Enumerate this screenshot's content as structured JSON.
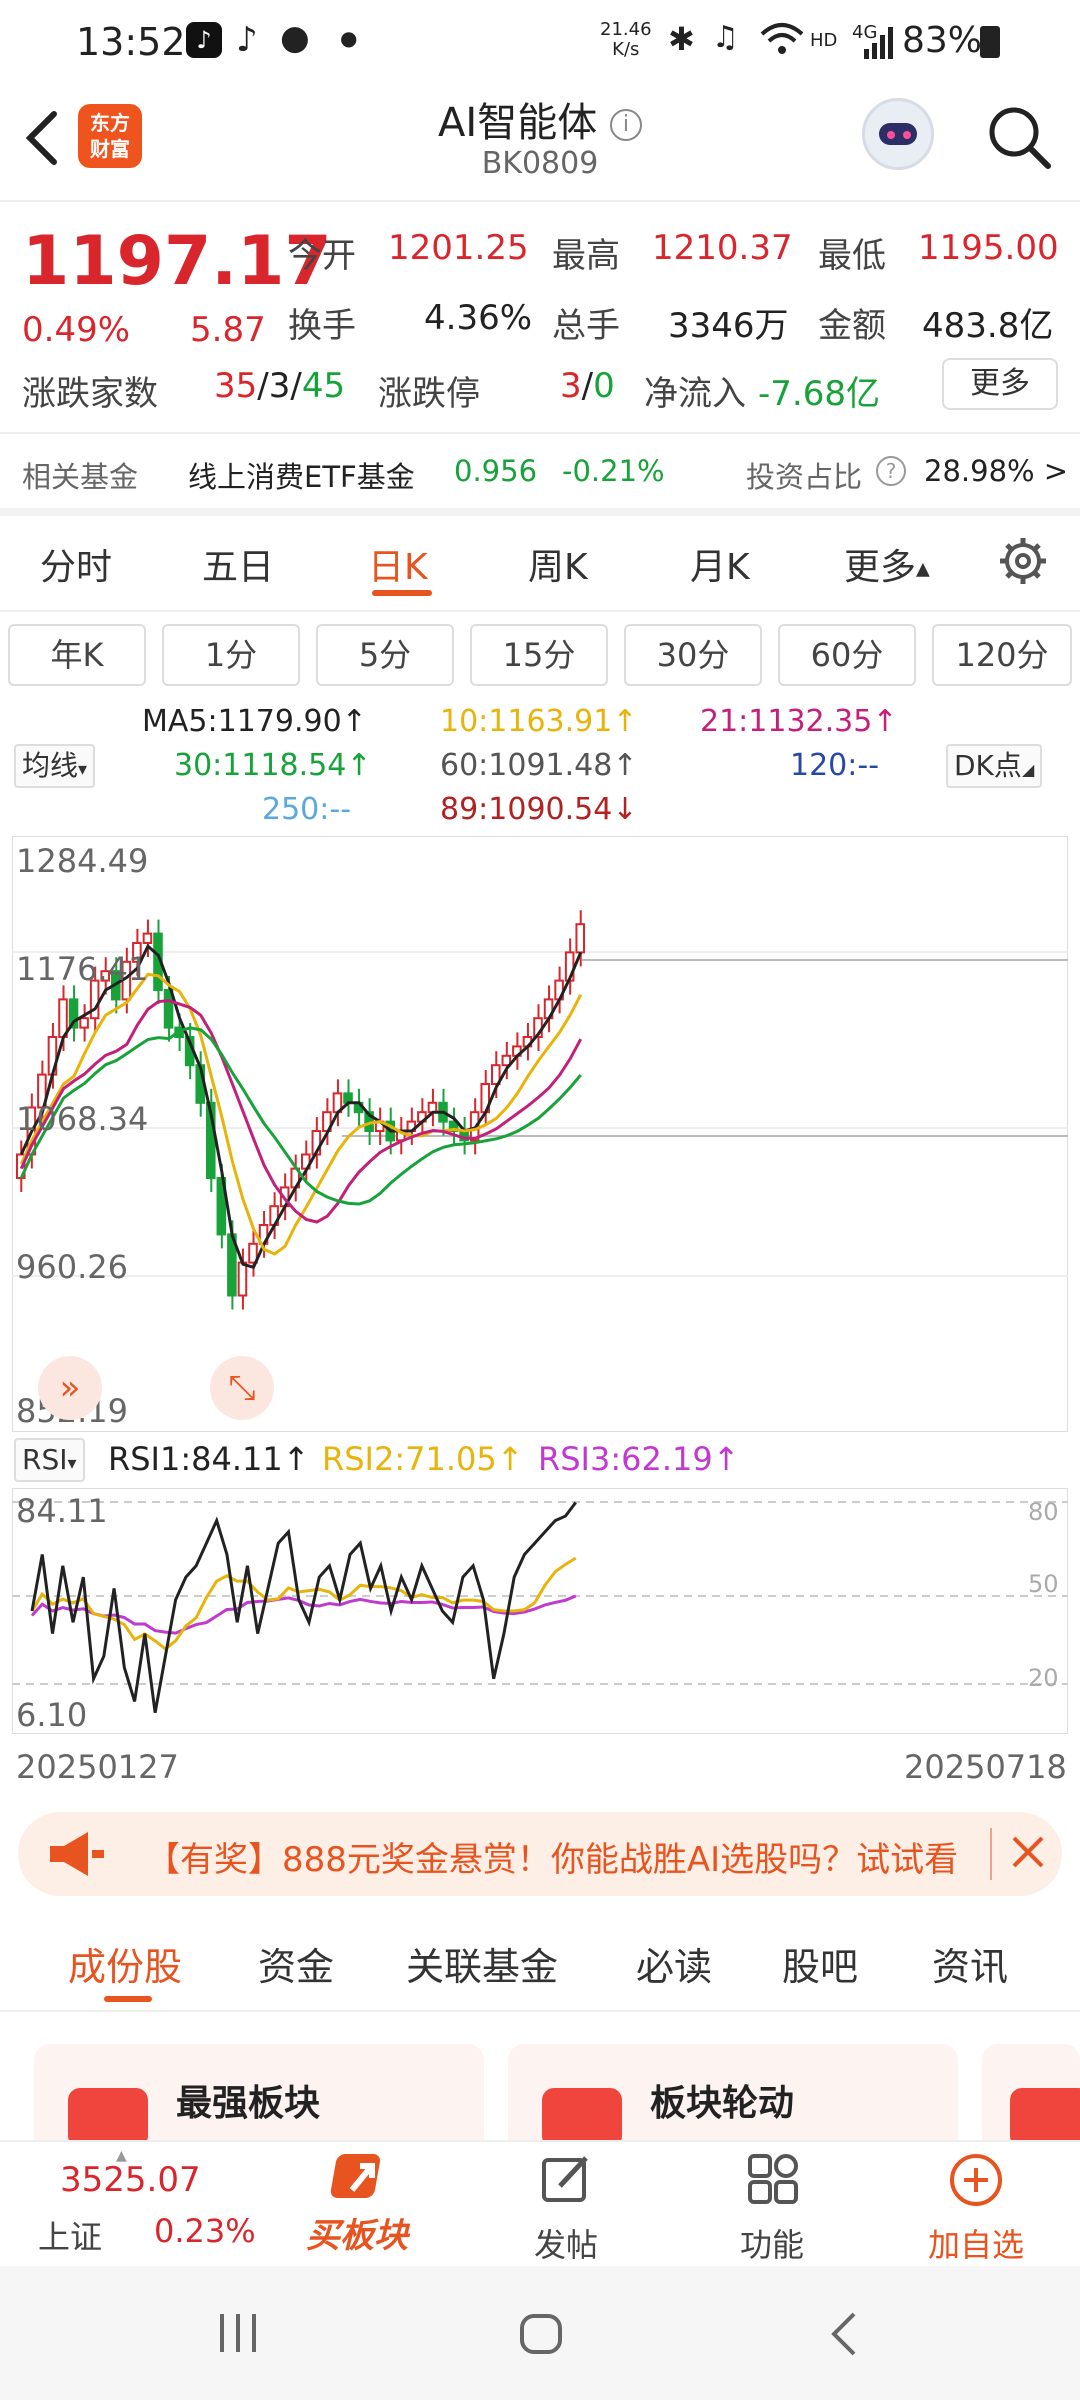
{
  "status_bar": {
    "time": "13:52",
    "net_speed_top": "21.46",
    "net_speed_unit": "K/s",
    "network": "HD",
    "signal": "4G",
    "battery": "83%"
  },
  "header": {
    "logo_text_1": "东方",
    "logo_text_2": "财富",
    "title": "AI智能体",
    "code": "BK0809"
  },
  "quote": {
    "price": "1197.17",
    "change_pct": "0.49%",
    "change": "5.87",
    "open_label": "今开",
    "open": "1201.25",
    "high_label": "最高",
    "high": "1210.37",
    "low_label": "最低",
    "low": "1195.00",
    "turnover_label": "换手",
    "turnover": "4.36%",
    "volume_label": "总手",
    "volume": "3346万",
    "amount_label": "金额",
    "amount": "483.8亿",
    "updown_label": "涨跌家数",
    "up_count": "35",
    "flat_count": "3",
    "down_count": "45",
    "limit_label": "涨跌停",
    "limit_up": "3",
    "limit_down": "0",
    "netflow_label": "净流入",
    "netflow": "-7.68亿",
    "more_label": "更多"
  },
  "fund": {
    "label": "相关基金",
    "name": "线上消费ETF基金",
    "price": "0.956",
    "change": "-0.21%",
    "ratio_label": "投资占比",
    "ratio": "28.98% >"
  },
  "period_tabs": [
    "分时",
    "五日",
    "日K",
    "周K",
    "月K",
    "更多"
  ],
  "minute_buttons": [
    "年K",
    "1分",
    "5分",
    "15分",
    "30分",
    "60分",
    "120分"
  ],
  "ma_legend": {
    "selector": "均线",
    "ma5": "MA5:1179.90↑",
    "ma10": "10:1163.91↑",
    "ma21": "21:1132.35↑",
    "ma30": "30:1118.54↑",
    "ma60": "60:1091.48↑",
    "ma120": "120:--",
    "ma250": "250:--",
    "ma89": "89:1090.54↓",
    "dk_button": "DK点"
  },
  "chart_data": {
    "type": "candlestick",
    "y_labels": [
      "1284.49",
      "1176.41",
      "1068.34",
      "960.26",
      "852.19"
    ],
    "ylim": [
      852.19,
      1284.49
    ],
    "x_start": "20250127",
    "x_end": "20250718",
    "rsi": {
      "selector": "RSI",
      "rsi1": "RSI1:84.11↑",
      "rsi2": "RSI2:71.05↑",
      "rsi3": "RSI3:62.19↑",
      "y_top": "84.11",
      "y_bottom": "6.10",
      "ref_levels": [
        "80",
        "50",
        "20"
      ]
    }
  },
  "promo": {
    "text": "【有奖】888元奖金悬赏！你能战胜AI选股吗？试试看"
  },
  "bottom_tabs": [
    "成份股",
    "资金",
    "关联基金",
    "必读",
    "股吧",
    "资讯"
  ],
  "cards": [
    {
      "title": "最强板块"
    },
    {
      "title": "板块轮动"
    }
  ],
  "toolbar": {
    "index_value": "3525.07",
    "index_name": "上证",
    "index_change": "0.23%",
    "buy_label": "买板块",
    "post_label": "发帖",
    "func_label": "功能",
    "add_label": "加自选"
  },
  "colors": {
    "up": "#d9262c",
    "down": "#18a23a",
    "accent": "#e8541f"
  }
}
